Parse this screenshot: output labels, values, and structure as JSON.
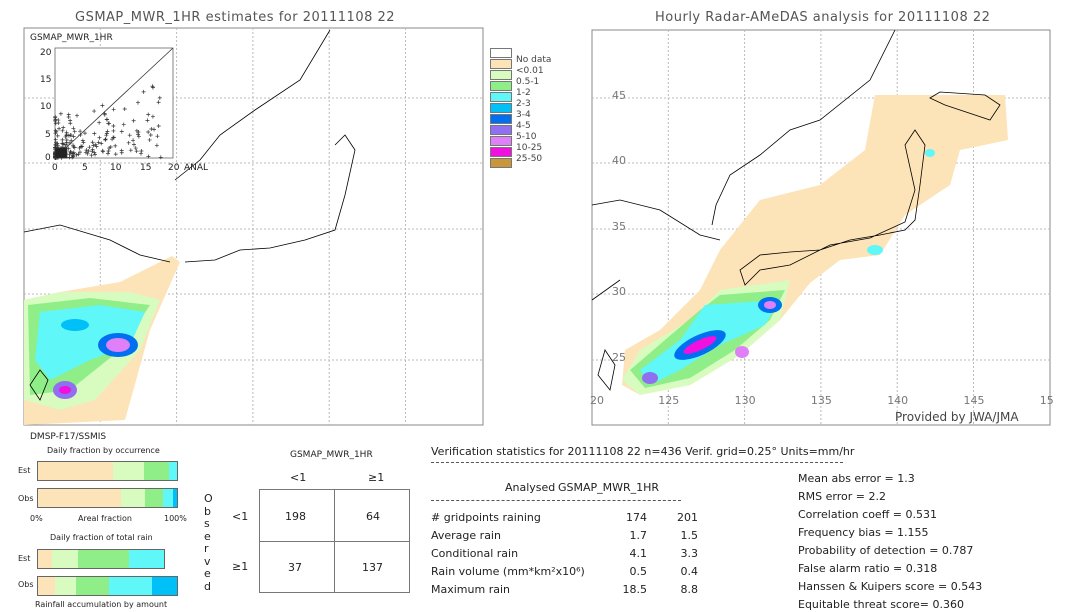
{
  "left_map": {
    "title": "GSMAP_MWR_1HR estimates for 20111108 22",
    "sensor": "DMSP-F17/SSMIS",
    "inset": {
      "ylabel": "GSMAP_MWR_1HR",
      "xlabel": "ANAL",
      "yticks": [
        "20",
        "15",
        "10",
        "5",
        "0"
      ],
      "xticks": [
        "0",
        "5",
        "10",
        "15",
        "20"
      ],
      "range": [
        0,
        20
      ]
    }
  },
  "right_map": {
    "title": "Hourly Radar-AMeDAS analysis for 20111108 22",
    "credit": "Provided by JWA/JMA",
    "lat_ticks": [
      "45",
      "40",
      "35",
      "30",
      "25"
    ],
    "lon_ticks": [
      "20",
      "125",
      "130",
      "135",
      "140",
      "145",
      "15"
    ]
  },
  "legend": [
    {
      "label": "",
      "color": "#ffffff"
    },
    {
      "label": "No data",
      "color": "#fde3b8"
    },
    {
      "label": "<0.01",
      "color": "#d8fcc0"
    },
    {
      "label": "0.5-1",
      "color": "#90ee88"
    },
    {
      "label": "1-2",
      "color": "#5ff7f7"
    },
    {
      "label": "2-3",
      "color": "#00c0f8"
    },
    {
      "label": "3-4",
      "color": "#0070f0"
    },
    {
      "label": "4-5",
      "color": "#9070f0"
    },
    {
      "label": "5-10",
      "color": "#e080f8"
    },
    {
      "label": "10-25",
      "color": "#f010e0"
    },
    {
      "label": "25-50",
      "color": "#c8963c"
    }
  ],
  "fractions": {
    "occ_title": "Daily fraction by occurrence",
    "rain_title": "Daily fraction of total rain",
    "acc_title": "Rainfall accumulation by amount",
    "est": "Est",
    "obs": "Obs",
    "x0": "0%",
    "xmid": "Areal fraction",
    "x1": "100%",
    "occ_est": [
      0.54,
      0.22,
      0.18,
      0.06
    ],
    "occ_obs": [
      0.6,
      0.17,
      0.13,
      0.07,
      0.03
    ],
    "rain_est": [
      0.1,
      0.19,
      0.37,
      0.25
    ],
    "rain_obs": [
      0.12,
      0.15,
      0.24,
      0.31,
      0.18
    ]
  },
  "contingency": {
    "header": "GSMAP_MWR_1HR",
    "col1": "<1",
    "col2": "≥1",
    "observed": "Observed",
    "row1": "<1",
    "row2": "≥1",
    "cells": [
      "198",
      "64",
      "37",
      "137"
    ]
  },
  "stats": {
    "title": "Verification statistics for 20111108 22  n=436  Verif. grid=0.25°  Units=mm/hr",
    "col_analysed": "Analysed",
    "col_gsmap": "GSMAP_MWR_1HR",
    "rows": [
      {
        "label": "# gridpoints raining",
        "a": "174",
        "g": "201"
      },
      {
        "label": "Average rain",
        "a": "1.7",
        "g": "1.5"
      },
      {
        "label": "Conditional rain",
        "a": "4.1",
        "g": "3.3"
      },
      {
        "label": "Rain volume (mm*km²x10⁶)",
        "a": "0.5",
        "g": "0.4"
      },
      {
        "label": "Maximum rain",
        "a": "18.5",
        "g": "8.8"
      }
    ],
    "scores": [
      "Mean abs error = 1.3",
      "RMS error = 2.2",
      "Correlation coeff = 0.531",
      "Frequency bias = 1.155",
      "Probability of detection = 0.787",
      "False alarm ratio = 0.318",
      "Hanssen & Kuipers score = 0.543",
      "Equitable threat score= 0.360"
    ]
  }
}
